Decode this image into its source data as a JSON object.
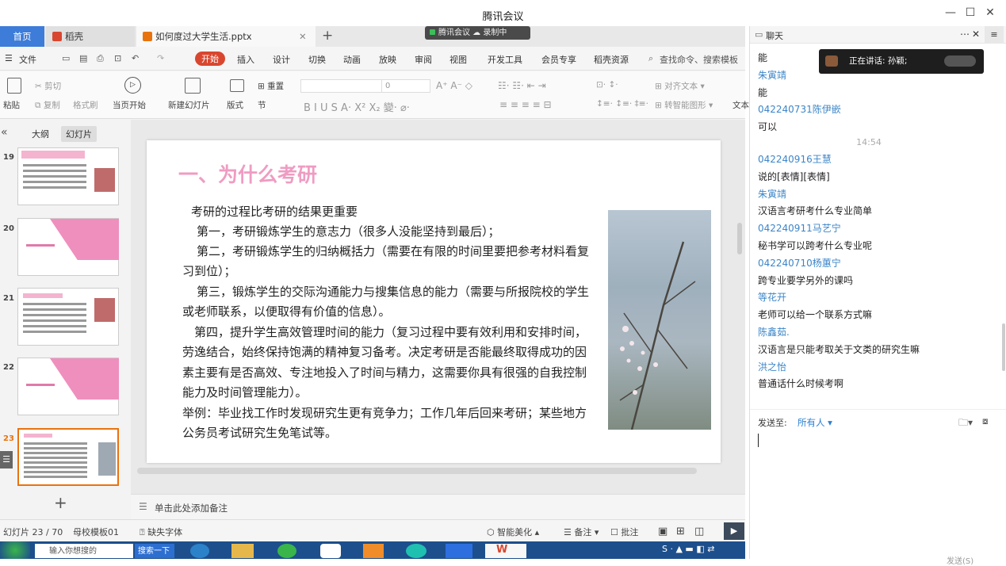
{
  "app": {
    "title": "腾讯会议"
  },
  "meeting_bar": {
    "status": "腾讯会议",
    "recording": "录制中"
  },
  "wps": {
    "tabs": [
      {
        "label": "首页"
      },
      {
        "label": "稻壳"
      },
      {
        "label": "如何度过大学生活.pptx"
      }
    ],
    "menu": {
      "file": "文件",
      "items": [
        "开始",
        "插入",
        "设计",
        "切换",
        "动画",
        "放映",
        "审阅",
        "视图",
        "开发工具",
        "会员专享",
        "稻壳资源"
      ],
      "search": "查找命令、搜索模板"
    },
    "ribbon": {
      "paste": "粘贴",
      "cut": "剪切",
      "copy": "复制",
      "format_painter": "格式刷",
      "slide_start": "当页开始",
      "new_slide": "新建幻灯片",
      "layout": "版式",
      "section": "节",
      "reset": "重置",
      "font_size": "0",
      "align_text": "对齐文本",
      "smart_shape": "转智能图形",
      "text": "文本"
    },
    "left_tabs": {
      "outline": "大纲",
      "slides": "幻灯片"
    },
    "thumbnails": [
      {
        "num": "19"
      },
      {
        "num": "20"
      },
      {
        "num": "21"
      },
      {
        "num": "22"
      },
      {
        "num": "23"
      }
    ],
    "slide": {
      "title": "一、为什么考研",
      "lines": [
        "考研的过程比考研的结果更重要",
        "第一，考研锻炼学生的意志力（很多人没能坚持到最后）；",
        "第二，考研锻炼学生的归纳概括力（需要在有限的时间里要把参考材料看复",
        "习到位）；",
        "第三，锻炼学生的交际沟通能力与搜集信息的能力（需要与所报院校的学生",
        "或老师联系，以便取得有价值的信息）。",
        "第四，提升学生高效管理时间的能力（复习过程中要有效利用和安排时间，",
        "劳逸结合，始终保持饱满的精神复习备考。决定考研是否能最终取得成功的因",
        "素主要有是否高效、专注地投入了时间与精力，这需要你具有很强的自我控制",
        "能力及时间管理能力）。",
        "举例：毕业找工作时发现研究生更有竞争力；工作几年后回来考研；某些地方",
        "公务员考试研究生免笔试等。"
      ]
    },
    "notes_placeholder": "单击此处添加备注",
    "status": {
      "slide_counter": "幻灯片 23 / 70",
      "template": "母校模板01",
      "missing_font": "缺失字体",
      "beautify": "智能美化",
      "notes": "备注",
      "comments": "批注"
    },
    "taskbar": {
      "input": "输入你想搜的",
      "search": "搜索一下"
    }
  },
  "chat": {
    "title": "聊天",
    "speaking": "正在讲话: 孙颖;",
    "messages": [
      {
        "type": "text",
        "text": "能"
      },
      {
        "type": "name",
        "text": "朱寅靖"
      },
      {
        "type": "text",
        "text": "能"
      },
      {
        "type": "name",
        "text": "042240731陈伊嵌"
      },
      {
        "type": "text",
        "text": "可以"
      },
      {
        "type": "time",
        "text": "14:54"
      },
      {
        "type": "name",
        "text": "042240916王慧"
      },
      {
        "type": "text",
        "text": "说的[表情][表情]"
      },
      {
        "type": "name",
        "text": "朱寅靖"
      },
      {
        "type": "text",
        "text": "汉语言考研考什么专业简单"
      },
      {
        "type": "name",
        "text": "042240911马艺宁"
      },
      {
        "type": "text",
        "text": "秘书学可以跨考什么专业呢"
      },
      {
        "type": "name",
        "text": "042240710杨蕙宁"
      },
      {
        "type": "text",
        "text": "跨专业要学另外的课吗"
      },
      {
        "type": "name",
        "text": "等花开"
      },
      {
        "type": "text",
        "text": "老师可以给一个联系方式嘛"
      },
      {
        "type": "name",
        "text": "陈鑫茹."
      },
      {
        "type": "text",
        "text": "汉语言是只能考取关于文类的研究生嘛"
      },
      {
        "type": "name",
        "text": "洪之怡"
      },
      {
        "type": "text",
        "text": "普通话什么时候考啊"
      }
    ],
    "send_to_label": "发送至:",
    "send_to_value": "所有人",
    "send_button": "发送(S)"
  }
}
